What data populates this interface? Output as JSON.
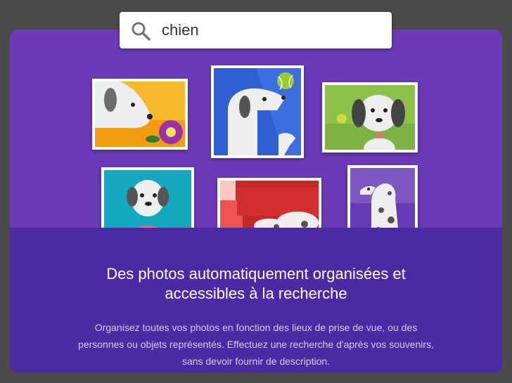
{
  "search": {
    "value": "chien",
    "icon": "search-icon"
  },
  "promo": {
    "headline_line1": "Des photos automatiquement organisées et",
    "headline_line2": "accessibles à la recherche",
    "description_line1": "Organisez toutes vos photos en fonction des lieux de prise de vue, ou des",
    "description_line2": "personnes ou objets représentés. Effectuez une recherche d'après vos souvenirs,",
    "description_line3": "sans devoir fournir de description."
  },
  "colors": {
    "background": "#4a4a4a",
    "hero_purple": "#6a3ab8",
    "panel_purple": "#4c2aa3"
  }
}
